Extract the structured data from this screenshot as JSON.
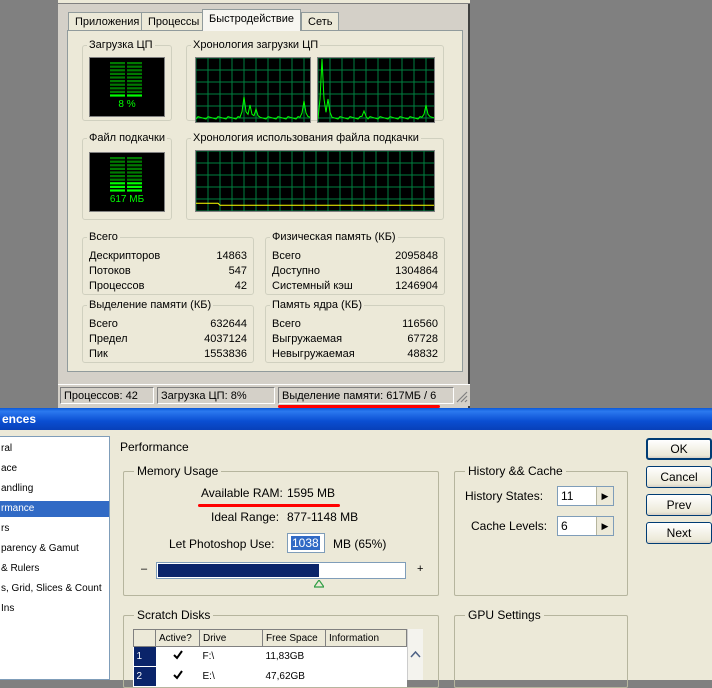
{
  "task_manager": {
    "tabs": [
      {
        "label": "Приложения"
      },
      {
        "label": "Процессы"
      },
      {
        "label": "Быстродействие"
      },
      {
        "label": "Сеть"
      }
    ],
    "active_tab": "Быстродействие",
    "cpu_usage": {
      "legend": "Загрузка ЦП",
      "value": "8 %",
      "fraction": 0.08
    },
    "cpu_history": {
      "legend": "Хронология загрузки ЦП"
    },
    "pagefile": {
      "legend": "Файл подкачки",
      "value": "617 МБ",
      "fraction": 0.3
    },
    "pagefile_history": {
      "legend": "Хронология использования файла подкачки"
    },
    "totals": {
      "legend": "Всего",
      "rows": [
        {
          "label": "Дескрипторов",
          "value": "14863"
        },
        {
          "label": "Потоков",
          "value": "547"
        },
        {
          "label": "Процессов",
          "value": "42"
        }
      ]
    },
    "physical_memory": {
      "legend": "Физическая память (КБ)",
      "rows": [
        {
          "label": "Всего",
          "value": "2095848"
        },
        {
          "label": "Доступно",
          "value": "1304864"
        },
        {
          "label": "Системный кэш",
          "value": "1246904"
        }
      ]
    },
    "commit_charge": {
      "legend": "Выделение памяти (КБ)",
      "rows": [
        {
          "label": "Всего",
          "value": "632644"
        },
        {
          "label": "Предел",
          "value": "4037124"
        },
        {
          "label": "Пик",
          "value": "1553836"
        }
      ]
    },
    "kernel_memory": {
      "legend": "Память ядра (КБ)",
      "rows": [
        {
          "label": "Всего",
          "value": "116560"
        },
        {
          "label": "Выгружаемая",
          "value": "67728"
        },
        {
          "label": "Невыгружаемая",
          "value": "48832"
        }
      ]
    },
    "statusbar": {
      "processes": "Процессов: 42",
      "cpu": "Загрузка ЦП: 8%",
      "commit": "Выделение памяти: 617МБ / 6"
    },
    "colors": {
      "graph_line": "#00ff00",
      "grid": "#008040",
      "pagefile_line": "#ffff00",
      "highlight": "#ff0000"
    }
  },
  "preferences": {
    "title": "ences",
    "categories": [
      {
        "label": "ral"
      },
      {
        "label": "ace"
      },
      {
        "label": "andling"
      },
      {
        "label": "rmance",
        "selected": true
      },
      {
        "label": "rs"
      },
      {
        "label": "parency & Gamut"
      },
      {
        "label": "& Rulers"
      },
      {
        "label": "s, Grid, Slices & Count"
      },
      {
        "label": "Ins"
      }
    ],
    "page_heading": "Performance",
    "memory_usage": {
      "legend": "Memory Usage",
      "available_label": "Available RAM:",
      "available_value": "1595 MB",
      "ideal_label": "Ideal Range:",
      "ideal_value": "877-1148 MB",
      "let_label": "Let Photoshop Use:",
      "let_value": "1038",
      "let_suffix": "MB (65%)",
      "slider_min": "–",
      "slider_max": "+",
      "slider_fraction": 0.65
    },
    "history_cache": {
      "legend": "History && Cache",
      "history_label": "History States:",
      "history_value": "11",
      "cache_label": "Cache Levels:",
      "cache_value": "6"
    },
    "buttons": {
      "ok": "OK",
      "cancel": "Cancel",
      "prev": "Prev",
      "next": "Next"
    },
    "scratch_disks": {
      "legend": "Scratch Disks",
      "columns": [
        "",
        "Active?",
        "Drive",
        "Free Space",
        "Information"
      ],
      "rows": [
        {
          "num": "1",
          "active": true,
          "drive": "F:\\",
          "free": "11,83GB",
          "info": ""
        },
        {
          "num": "2",
          "active": true,
          "drive": "E:\\",
          "free": "47,62GB",
          "info": ""
        }
      ]
    },
    "gpu": {
      "legend": "GPU Settings"
    }
  }
}
